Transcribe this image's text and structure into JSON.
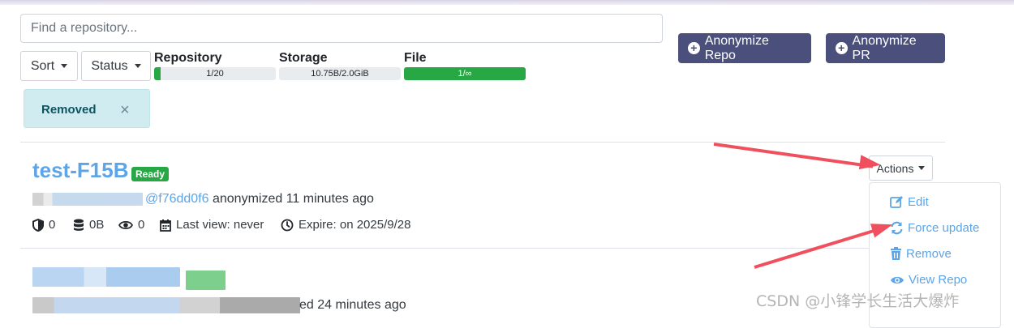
{
  "search": {
    "placeholder": "Find a repository..."
  },
  "filters": {
    "sort_label": "Sort",
    "status_label": "Status"
  },
  "quotas": [
    {
      "label": "Repository",
      "value_text": "1/20",
      "fraction": 0.05
    },
    {
      "label": "Storage",
      "value_text": "10.75B/2.0GiB",
      "fraction": 0.0
    },
    {
      "label": "File",
      "value_text": "1/∞",
      "fraction": 1.0
    }
  ],
  "buttons": {
    "anonymize_repo": "Anonymize Repo",
    "anonymize_pr": "Anonymize PR"
  },
  "active_filter": {
    "label": "Removed",
    "close": "×"
  },
  "repo": {
    "name": "test-F15B",
    "status_badge": "Ready",
    "commit": "@f76dd0f6",
    "anonymized_text": "anonymized 11 minutes ago",
    "stats": {
      "count1": "0",
      "storage": "0B",
      "views": "0",
      "last_view": "Last view: never",
      "expire": "Expire: on 2025/9/28"
    }
  },
  "actions": {
    "button_label": "Actions",
    "menu": [
      {
        "label": "Edit",
        "icon": "edit-icon"
      },
      {
        "label": "Force update",
        "icon": "sync-icon"
      },
      {
        "label": "Remove",
        "icon": "trash-icon"
      },
      {
        "label": "View Repo",
        "icon": "eye-icon"
      }
    ]
  },
  "second_repo": {
    "meta_partial": "ed 24 minutes ago"
  },
  "watermark": "CSDN @小锋学长生活大爆炸",
  "colors": {
    "accent": "#5ba5e8",
    "button": "#4a4f7c",
    "success": "#28a745",
    "arrow": "#f0505e"
  }
}
